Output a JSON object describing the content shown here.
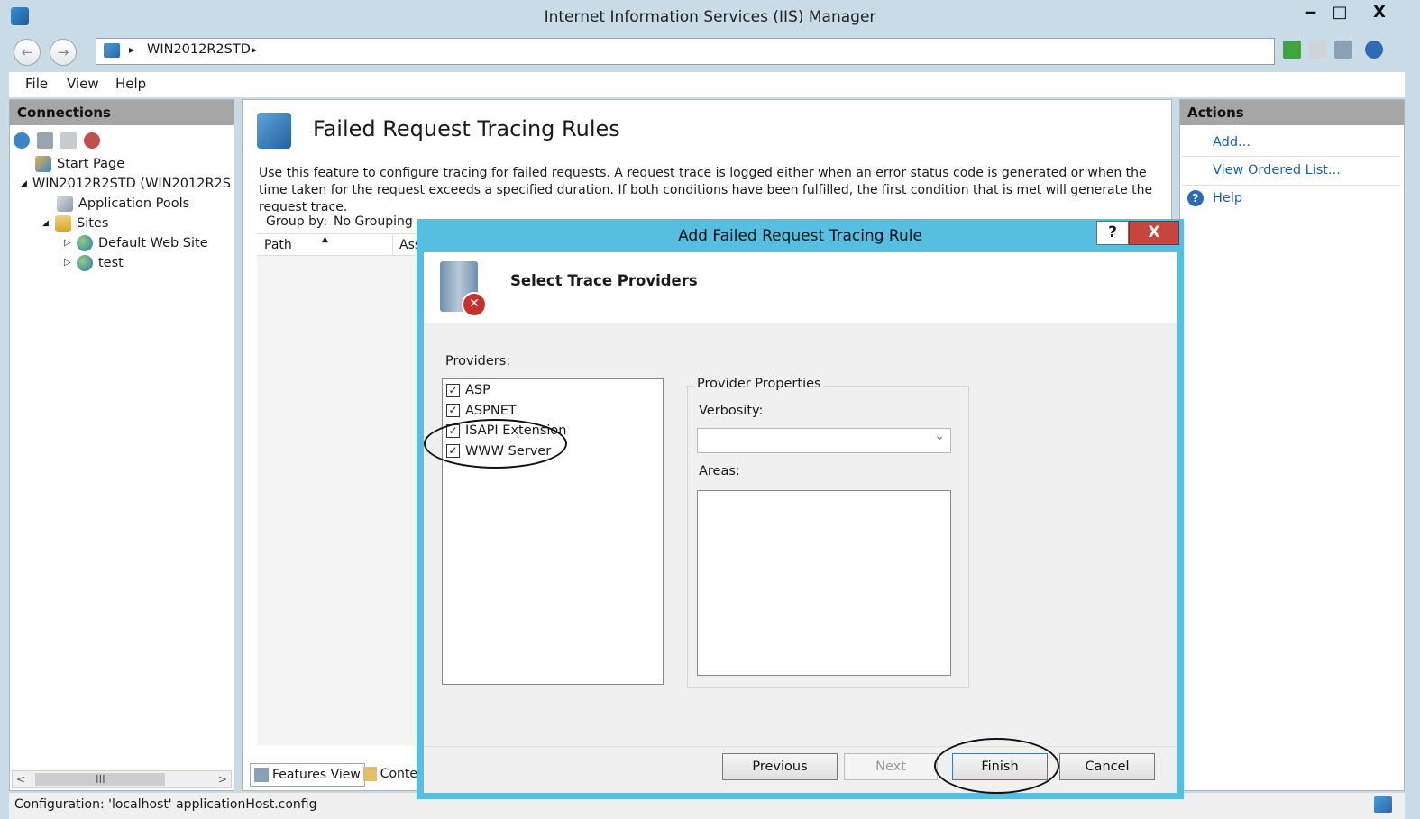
{
  "window": {
    "title": "Internet Information Services (IIS) Manager",
    "minimize": "‒",
    "maximize": "□",
    "close": "X"
  },
  "nav": {
    "back": "←",
    "forward": "→",
    "sep1": "▸",
    "path_node": "WIN2012R2STD",
    "sep2": "▸"
  },
  "menu": {
    "file": "File",
    "view": "View",
    "help": "Help"
  },
  "connections": {
    "title": "Connections",
    "tree": [
      {
        "label": "Start Page",
        "icon": "start-page-icon"
      },
      {
        "label": "WIN2012R2STD (WIN2012R2S",
        "icon": "server-icon",
        "toggle": "◢"
      },
      {
        "label": "Application Pools",
        "icon": "app-pools-icon"
      },
      {
        "label": "Sites",
        "icon": "sites-folder-icon",
        "toggle": "◢"
      },
      {
        "label": "Default Web Site",
        "icon": "globe-icon",
        "toggle": "▷"
      },
      {
        "label": "test",
        "icon": "globe-icon",
        "toggle": "▷"
      }
    ],
    "scroll_left": "<",
    "scroll_thumb": "III",
    "scroll_right": ">"
  },
  "main": {
    "heading": "Failed Request Tracing Rules",
    "description": "Use this feature to configure tracing for failed requests. A request trace is logged either when an error status code is generated or when the time taken for the request exceeds a specified duration. If both conditions have been fulfilled, the first condition that is met will generate the request trace.",
    "group_by_label": "Group by:",
    "group_by_value": "No Grouping",
    "col_path": "Path",
    "col_ass": "Ass",
    "sort_arrow": "▲",
    "tab_features": "Features View",
    "tab_content": "Conte"
  },
  "actions": {
    "title": "Actions",
    "add": "Add...",
    "view_ordered": "View Ordered List...",
    "help": "Help",
    "help_glyph": "?"
  },
  "status": {
    "text": "Configuration: 'localhost' applicationHost.config"
  },
  "dialog": {
    "title": "Add Failed Request Tracing Rule",
    "help_btn": "?",
    "close_btn": "X",
    "heading": "Select Trace Providers",
    "providers_label": "Providers:",
    "providers": [
      {
        "label": "ASP",
        "checked": true
      },
      {
        "label": "ASPNET",
        "checked": true
      },
      {
        "label": "ISAPI Extension",
        "checked": true
      },
      {
        "label": "WWW Server",
        "checked": true
      }
    ],
    "check_glyph": "✓",
    "props_label": "Provider Properties",
    "verbosity_label": "Verbosity:",
    "verbosity_value": "",
    "dropdown_arrow": "⌄",
    "areas_label": "Areas:",
    "buttons": {
      "previous": "Previous",
      "next": "Next",
      "finish": "Finish",
      "cancel": "Cancel"
    }
  }
}
